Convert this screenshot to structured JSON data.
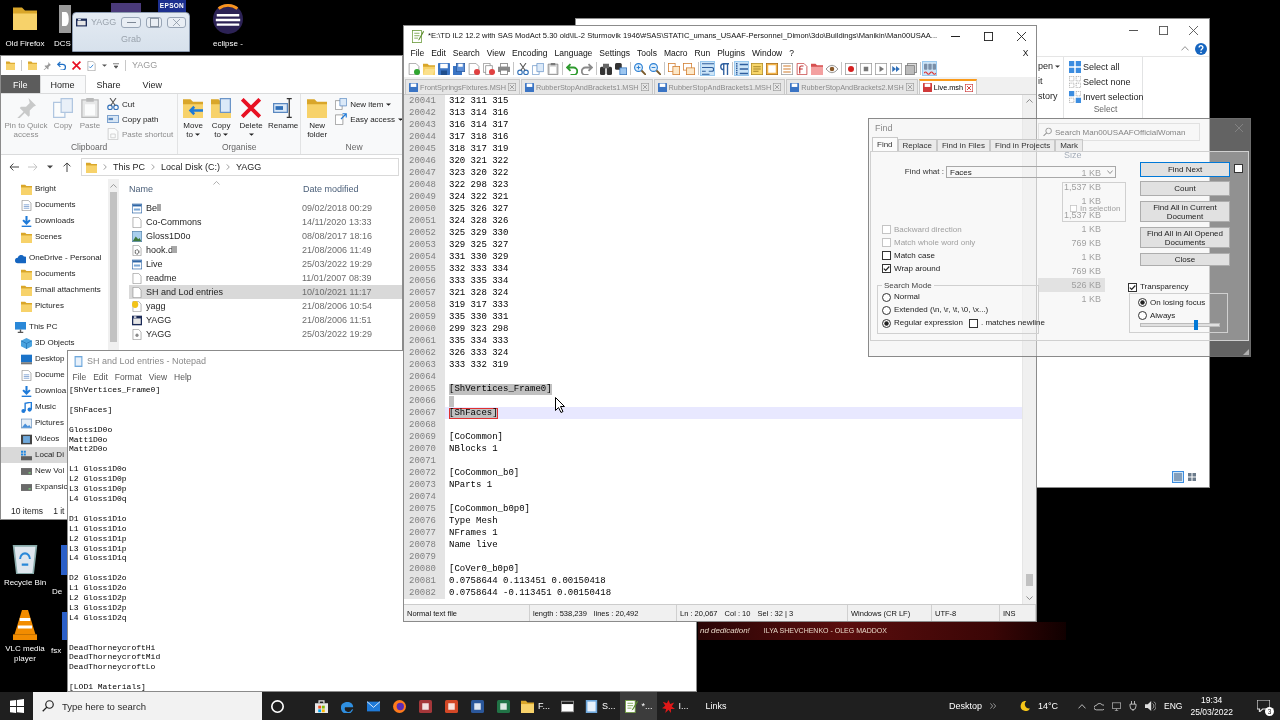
{
  "desktop_icons": [
    {
      "kind": "folder",
      "label": "Old Firefox"
    },
    {
      "kind": "dcs",
      "label": "DCS"
    },
    {
      "kind": "media_partial"
    },
    {
      "kind": "printer_logo",
      "logo_text": "EPSON"
    },
    {
      "kind": "eclipse",
      "label": "eclipse -"
    },
    {
      "kind": "recycle_bin",
      "label": "Recycle Bin"
    },
    {
      "kind": "cone",
      "label": "VLC media player"
    },
    {
      "kind": "strip",
      "label": "De"
    },
    {
      "kind": "strip",
      "label": "fsx"
    }
  ],
  "yagg_window": {
    "title": "YAGG",
    "button": "Grab",
    "disabled": true
  },
  "explorer": {
    "title": "YAGG",
    "tabs": [
      {
        "label": "File",
        "kind": "menu",
        "selected": false
      },
      {
        "label": "Home",
        "kind": "tab",
        "selected": true
      },
      {
        "label": "Share",
        "kind": "tab",
        "selected": false
      },
      {
        "label": "View",
        "kind": "tab",
        "selected": false
      }
    ],
    "ribbon": [
      {
        "label": "Clipboard",
        "buttons": [
          {
            "kind": "pin",
            "label": "Pin to Quick access",
            "disabled": true
          },
          {
            "kind": "copy",
            "label": "Copy",
            "disabled": true
          },
          {
            "kind": "paste",
            "label": "Paste",
            "disabled": true
          },
          {
            "kind": "cut",
            "label": "Cut",
            "disabled": false
          },
          {
            "kind": "copy_path",
            "label": "Copy path",
            "disabled": false
          },
          {
            "kind": "paste_shortcut",
            "label": "Paste shortcut",
            "disabled": true
          }
        ]
      },
      {
        "label": "Organise",
        "buttons": [
          {
            "kind": "move_to",
            "label": "Move to",
            "dropdown": true,
            "disabled": false
          },
          {
            "kind": "copy_to",
            "label": "Copy to",
            "dropdown": true,
            "disabled": false
          },
          {
            "kind": "delete",
            "label": "Delete",
            "dropdown": true,
            "disabled": false
          },
          {
            "kind": "rename",
            "label": "Rename",
            "disabled": false
          }
        ]
      },
      {
        "label": "New",
        "buttons": [
          {
            "kind": "new_folder",
            "label": "New folder",
            "disabled": false
          },
          {
            "kind": "new_item",
            "label": "New item",
            "dropdown": true,
            "disabled": false
          },
          {
            "kind": "easy_access",
            "label": "Easy access",
            "dropdown": true,
            "disabled": false
          }
        ]
      }
    ],
    "nav_buttons": [
      {
        "kind": "back",
        "disabled": false
      },
      {
        "kind": "forward",
        "disabled": true
      },
      {
        "kind": "recent",
        "disabled": false
      },
      {
        "kind": "up",
        "disabled": false
      }
    ],
    "path": [
      "This PC",
      "Local Disk (C:)",
      "YAGG"
    ],
    "nav_pane": [
      {
        "children": [
          {
            "kind": "folder",
            "label": "Bright",
            "selected": false
          },
          {
            "kind": "documents",
            "label": "Documents",
            "selected": false
          },
          {
            "kind": "downloads",
            "label": "Downloads",
            "selected": false
          },
          {
            "kind": "folder",
            "label": "Scenes",
            "selected": false
          }
        ]
      },
      {
        "kind": "cloud",
        "label": "OneDrive - Personal",
        "selected": false,
        "children": [
          {
            "kind": "folder",
            "label": "Documents",
            "selected": false
          },
          {
            "kind": "folder",
            "label": "Email attachments",
            "selected": false
          },
          {
            "kind": "folder",
            "label": "Pictures",
            "selected": false
          }
        ]
      },
      {
        "kind": "pc",
        "label": "This PC",
        "selected": false,
        "children": [
          {
            "kind": "cube",
            "label": "3D Objects",
            "selected": false
          },
          {
            "kind": "desktop",
            "label": "Desktop",
            "selected": false
          },
          {
            "kind": "documents",
            "label": "Docume",
            "selected": false
          },
          {
            "kind": "downloads",
            "label": "Downloa",
            "selected": false
          },
          {
            "kind": "music",
            "label": "Music",
            "selected": false
          },
          {
            "kind": "pictures",
            "label": "Pictures",
            "selected": false
          },
          {
            "kind": "videos",
            "label": "Videos",
            "selected": false
          },
          {
            "kind": "drive_c",
            "label": "Local Di",
            "selected": true
          },
          {
            "kind": "drive",
            "label": "New Vol",
            "selected": false
          },
          {
            "kind": "drive",
            "label": "Expansic",
            "selected": false
          }
        ]
      }
    ],
    "columns": [
      "Name",
      "Date modified"
    ],
    "files": [
      {
        "kind": "window",
        "name": "Bell",
        "date": "09/02/2018 00:29",
        "selected": false
      },
      {
        "kind": "file",
        "name": "Co-Commons",
        "date": "14/11/2020 13:33",
        "selected": false
      },
      {
        "kind": "image",
        "name": "Gloss1D0o",
        "date": "08/08/2017 18:16",
        "selected": false
      },
      {
        "kind": "dll",
        "name": "hook.dll",
        "date": "21/08/2006 11:49",
        "selected": false
      },
      {
        "kind": "window",
        "name": "Live",
        "date": "25/03/2022 19:29",
        "selected": false
      },
      {
        "kind": "file",
        "name": "readme",
        "date": "11/01/2007 08:39",
        "selected": false
      },
      {
        "kind": "file",
        "name": "SH and Lod entries",
        "date": "10/10/2021 11:17",
        "selected": true
      },
      {
        "kind": "help",
        "name": "yagg",
        "date": "21/08/2006 10:54",
        "selected": false
      },
      {
        "kind": "app",
        "name": "YAGG",
        "date": "21/08/2006 11:51",
        "selected": false
      },
      {
        "kind": "config",
        "name": "YAGG",
        "date": "25/03/2022 19:29",
        "selected": false
      }
    ],
    "status": [
      "10 items",
      "1 it"
    ]
  },
  "explorer_behind": {
    "ribbon_cut": [
      {
        "label": "pen",
        "dropdown": true
      },
      {
        "label": "it"
      },
      {
        "label": "story"
      }
    ],
    "select_group": {
      "label": "Select",
      "buttons": [
        {
          "kind": "select_all",
          "label": "Select all"
        },
        {
          "kind": "select_none",
          "label": "Select none"
        },
        {
          "kind": "invert",
          "label": "Invert selection"
        }
      ]
    },
    "search": {
      "placeholder": "Search Man00USAAFOfficialWoman"
    },
    "size_column": "Size",
    "sizes": [
      {
        "text": "1 KB",
        "selected": false
      },
      {
        "text": "1,537 KB",
        "selected": false
      },
      {
        "text": "1 KB",
        "selected": false
      },
      {
        "text": "1,537 KB",
        "selected": false
      },
      {
        "text": "1 KB",
        "selected": false
      },
      {
        "text": "769 KB",
        "selected": false
      },
      {
        "text": "1 KB",
        "selected": false
      },
      {
        "text": "769 KB",
        "selected": false
      },
      {
        "text": "526 KB",
        "selected": true
      },
      {
        "text": "1 KB",
        "selected": false
      }
    ],
    "views": [
      {
        "kind": "details",
        "selected": true
      },
      {
        "kind": "tiles",
        "selected": false
      }
    ]
  },
  "banner": {
    "texts": [
      "nd dedication!",
      "ILYA SHEVCHENKO - OLEG MADDOX"
    ]
  },
  "notepad": {
    "title": "SH and Lod entries - Notepad",
    "menu": [
      "File",
      "Edit",
      "Format",
      "View",
      "Help"
    ],
    "content": "[ShVertices_Frame0]\n\n[ShFaces]\n\nGloss1D0o\nMatt1D0o\nMatt2D0o\n\nL1 Gloss1D0o\nL2 Gloss1D0p\nL3 Gloss1D0p\nL4 Gloss1D0q\n\nD1 Gloss1D1o\nL1 Gloss1D1o\nL2 Gloss1D1p\nL3 Gloss1D1p\nL4 Gloss1D1q\n\nD2 Gloss1D2o\nL1 Gloss1D2o\nL2 Gloss1D2p\nL3 Gloss1D2p\nL4 Gloss1D2q\n\n\nDeadThorneycroftHi\nDeadThorneycroftMid\nDeadThorneycroftLo\n\n[LOD1 Materials]"
  },
  "notepadpp": {
    "title": "*E:\\TD IL2 12.2 with SAS ModAct 5.30 old\\IL-2 Sturmovik 1946\\#SAS\\STATIC_umans_USAAF-Personnel_Dimon\\3do\\Buildings\\Manikin\\Man00USAA...",
    "menu": [
      "File",
      "Edit",
      "Search",
      "View",
      "Encoding",
      "Language",
      "Settings",
      "Tools",
      "Macro",
      "Run",
      "Plugins",
      "Window",
      "?"
    ],
    "close_document": "X",
    "toolbar": [
      [
        {
          "kind": "new",
          "pressed": false
        },
        {
          "kind": "open",
          "pressed": false
        },
        {
          "kind": "save",
          "pressed": false
        },
        {
          "kind": "save_all",
          "pressed": false
        },
        {
          "kind": "close",
          "pressed": false
        },
        {
          "kind": "close_all",
          "pressed": false
        },
        {
          "kind": "print",
          "pressed": false
        }
      ],
      [
        {
          "kind": "cut",
          "pressed": false
        },
        {
          "kind": "copy",
          "pressed": false
        },
        {
          "kind": "paste",
          "pressed": false
        }
      ],
      [
        {
          "kind": "undo",
          "pressed": false
        },
        {
          "kind": "redo",
          "pressed": false
        }
      ],
      [
        {
          "kind": "find",
          "pressed": false
        },
        {
          "kind": "replace",
          "pressed": false
        }
      ],
      [
        {
          "kind": "zoom_in",
          "pressed": false
        },
        {
          "kind": "zoom_out",
          "pressed": false
        }
      ],
      [
        {
          "kind": "sync_v",
          "pressed": false
        },
        {
          "kind": "sync_h",
          "pressed": false
        }
      ],
      [
        {
          "kind": "wrap",
          "pressed": true
        },
        {
          "kind": "all_chars",
          "pressed": false
        }
      ],
      [
        {
          "kind": "indent",
          "pressed": true
        },
        {
          "kind": "udl",
          "pressed": false
        },
        {
          "kind": "docmap",
          "pressed": false
        },
        {
          "kind": "funclist",
          "pressed": false
        },
        {
          "kind": "function_file",
          "pressed": false
        },
        {
          "kind": "folder_ws",
          "pressed": false
        },
        {
          "kind": "monitor",
          "pressed": false
        }
      ],
      [
        {
          "kind": "record",
          "pressed": false
        },
        {
          "kind": "stop",
          "pressed": false
        },
        {
          "kind": "play",
          "pressed": false
        },
        {
          "kind": "play_multi",
          "pressed": false
        },
        {
          "kind": "save_macro",
          "pressed": false
        }
      ],
      [
        {
          "kind": "spell",
          "pressed": true
        }
      ]
    ],
    "tabs": [
      {
        "label": "FrontSpringsFixtures.MSH",
        "selected": false,
        "modified": false
      },
      {
        "label": "RubberStopAndBrackets1.MSH",
        "selected": false,
        "modified": false
      },
      {
        "label": "RubberStopAndBrackets1.MSH",
        "selected": false,
        "modified": false
      },
      {
        "label": "RubberStopAndBrackets2.MSH",
        "selected": false,
        "modified": false
      },
      {
        "label": "Live.msh",
        "selected": true,
        "modified": true
      }
    ],
    "lines": [
      {
        "number": "20041",
        "text": "312 311 315",
        "selected": false,
        "current": false,
        "outlined": false
      },
      {
        "number": "20042",
        "text": "313 314 316",
        "selected": false,
        "current": false,
        "outlined": false
      },
      {
        "number": "20043",
        "text": "316 314 317",
        "selected": false,
        "current": false,
        "outlined": false
      },
      {
        "number": "20044",
        "text": "317 318 316",
        "selected": false,
        "current": false,
        "outlined": false
      },
      {
        "number": "20045",
        "text": "318 317 319",
        "selected": false,
        "current": false,
        "outlined": false
      },
      {
        "number": "20046",
        "text": "320 321 322",
        "selected": false,
        "current": false,
        "outlined": false
      },
      {
        "number": "20047",
        "text": "323 320 322",
        "selected": false,
        "current": false,
        "outlined": false
      },
      {
        "number": "20048",
        "text": "322 298 323",
        "selected": false,
        "current": false,
        "outlined": false
      },
      {
        "number": "20049",
        "text": "324 322 321",
        "selected": false,
        "current": false,
        "outlined": false
      },
      {
        "number": "20050",
        "text": "325 326 327",
        "selected": false,
        "current": false,
        "outlined": false
      },
      {
        "number": "20051",
        "text": "324 328 326",
        "selected": false,
        "current": false,
        "outlined": false
      },
      {
        "number": "20052",
        "text": "325 329 330",
        "selected": false,
        "current": false,
        "outlined": false
      },
      {
        "number": "20053",
        "text": "329 325 327",
        "selected": false,
        "current": false,
        "outlined": false
      },
      {
        "number": "20054",
        "text": "331 330 329",
        "selected": false,
        "current": false,
        "outlined": false
      },
      {
        "number": "20055",
        "text": "332 333 334",
        "selected": false,
        "current": false,
        "outlined": false
      },
      {
        "number": "20056",
        "text": "333 335 334",
        "selected": false,
        "current": false,
        "outlined": false
      },
      {
        "number": "20057",
        "text": "321 328 324",
        "selected": false,
        "current": false,
        "outlined": false
      },
      {
        "number": "20058",
        "text": "319 317 333",
        "selected": false,
        "current": false,
        "outlined": false
      },
      {
        "number": "20059",
        "text": "335 330 331",
        "selected": false,
        "current": false,
        "outlined": false
      },
      {
        "number": "20060",
        "text": "299 323 298",
        "selected": false,
        "current": false,
        "outlined": false
      },
      {
        "number": "20061",
        "text": "335 334 333",
        "selected": false,
        "current": false,
        "outlined": false
      },
      {
        "number": "20062",
        "text": "326 333 324",
        "selected": false,
        "current": false,
        "outlined": false
      },
      {
        "number": "20063",
        "text": "333 332 319",
        "selected": false,
        "current": false,
        "outlined": false
      },
      {
        "number": "20064",
        "selected": false,
        "current": false,
        "outlined": false
      },
      {
        "number": "20065",
        "text": "[ShVertices_Frame0]",
        "selected": true,
        "current": false,
        "outlined": false
      },
      {
        "number": "20066",
        "selected": true,
        "current": false,
        "outlined": false
      },
      {
        "number": "20067",
        "text": "[ShFaces]",
        "selected": true,
        "current": true,
        "outlined": true
      },
      {
        "number": "20068",
        "selected": false,
        "current": false,
        "outlined": false
      },
      {
        "number": "20069",
        "text": "[CoCommon]",
        "selected": false,
        "current": false,
        "outlined": false
      },
      {
        "number": "20070",
        "text": "NBlocks 1",
        "selected": false,
        "current": false,
        "outlined": false
      },
      {
        "number": "20071",
        "selected": false,
        "current": false,
        "outlined": false
      },
      {
        "number": "20072",
        "text": "[CoCommon_b0]",
        "selected": false,
        "current": false,
        "outlined": false
      },
      {
        "number": "20073",
        "text": "NParts 1",
        "selected": false,
        "current": false,
        "outlined": false
      },
      {
        "number": "20074",
        "selected": false,
        "current": false,
        "outlined": false
      },
      {
        "number": "20075",
        "text": "[CoCommon_b0p0]",
        "selected": false,
        "current": false,
        "outlined": false
      },
      {
        "number": "20076",
        "text": "Type Mesh",
        "selected": false,
        "current": false,
        "outlined": false
      },
      {
        "number": "20077",
        "text": "NFrames 1",
        "selected": false,
        "current": false,
        "outlined": false
      },
      {
        "number": "20078",
        "text": "Name live",
        "selected": false,
        "current": false,
        "outlined": false
      },
      {
        "number": "20079",
        "selected": false,
        "current": false,
        "outlined": false
      },
      {
        "number": "20080",
        "text": "[CoVer0_b0p0]",
        "selected": false,
        "current": false,
        "outlined": false
      },
      {
        "number": "20081",
        "text": "0.0758644 0.113451 0.00150418",
        "selected": false,
        "current": false,
        "outlined": false
      },
      {
        "number": "20082",
        "text": "0.0758644 -0.113451 0.00150418",
        "selected": false,
        "current": false,
        "outlined": false
      }
    ],
    "status": [
      [
        "Normal text file"
      ],
      [
        "length : 538,239",
        "lines : 20,492"
      ],
      [
        "Ln : 20,067",
        "Col : 10",
        "Sel : 32 | 3"
      ],
      [
        "Windows (CR LF)"
      ],
      [
        "UTF-8"
      ],
      [
        "INS"
      ]
    ]
  },
  "find_dialog": {
    "title": "Find",
    "tabs": [
      {
        "label": "Find",
        "selected": true
      },
      {
        "label": "Replace",
        "selected": false
      },
      {
        "label": "Find in Files",
        "selected": false
      },
      {
        "label": "Find in Projects",
        "selected": false
      },
      {
        "label": "Mark",
        "selected": false
      }
    ],
    "find_what": {
      "label": "Find what :",
      "value": "Faces"
    },
    "in_selection": {
      "label": "In selection",
      "checked": false,
      "disabled": true
    },
    "options": [
      {
        "label": "Backward direction",
        "checked": false,
        "disabled": true
      },
      {
        "label": "Match whole word only",
        "checked": false,
        "disabled": true
      },
      {
        "label": "Match case",
        "checked": false,
        "disabled": false
      },
      {
        "label": "Wrap around",
        "checked": true,
        "disabled": false
      }
    ],
    "search_mode": {
      "label": "Search Mode",
      "modes": [
        {
          "label": "Normal",
          "selected": false
        },
        {
          "label": "Extended (\\n, \\r, \\t, \\0, \\x...)",
          "selected": false
        },
        {
          "label": "Regular expression",
          "selected": true
        }
      ],
      "matches_newline": {
        "label": ". matches newline",
        "checked": false
      }
    },
    "buttons": [
      {
        "label": "Find Next",
        "focused": true
      },
      {
        "label": "Count",
        "focused": false
      },
      {
        "label": "Find All in Current Document",
        "focused": false
      },
      {
        "label": "Find All in All Opened Documents",
        "focused": false
      },
      {
        "label": "Close",
        "focused": false
      }
    ],
    "side_checkbox": {
      "checked": false
    },
    "transparency": {
      "label": "Transparency",
      "checked": true,
      "modes": [
        {
          "label": "On losing focus",
          "selected": true
        },
        {
          "label": "Always",
          "selected": false
        }
      ],
      "level": 0.7
    }
  },
  "taskbar": {
    "search": {
      "placeholder": "Type here to search"
    },
    "apps": [
      {
        "kind": "store",
        "active": false
      },
      {
        "kind": "edge",
        "active": false
      },
      {
        "kind": "mail",
        "active": false
      },
      {
        "kind": "firefox",
        "active": false
      },
      {
        "kind": "access",
        "active": false
      },
      {
        "kind": "powerpoint",
        "active": false
      },
      {
        "kind": "word",
        "active": false
      },
      {
        "kind": "excel",
        "active": false
      },
      {
        "kind": "explorer",
        "label": "F...",
        "active": false
      },
      {
        "kind": "window",
        "active": false
      },
      {
        "kind": "notepad",
        "label": "S...",
        "active": false
      },
      {
        "kind": "notepadpp",
        "label": "*...",
        "active": true
      },
      {
        "kind": "splat",
        "label": "I...",
        "active": false
      }
    ],
    "links": "Links",
    "desktop": "Desktop",
    "temperature": "14°C",
    "language": "ENG",
    "time": "19:34",
    "date": "25/03/2022",
    "notifications": "3"
  }
}
